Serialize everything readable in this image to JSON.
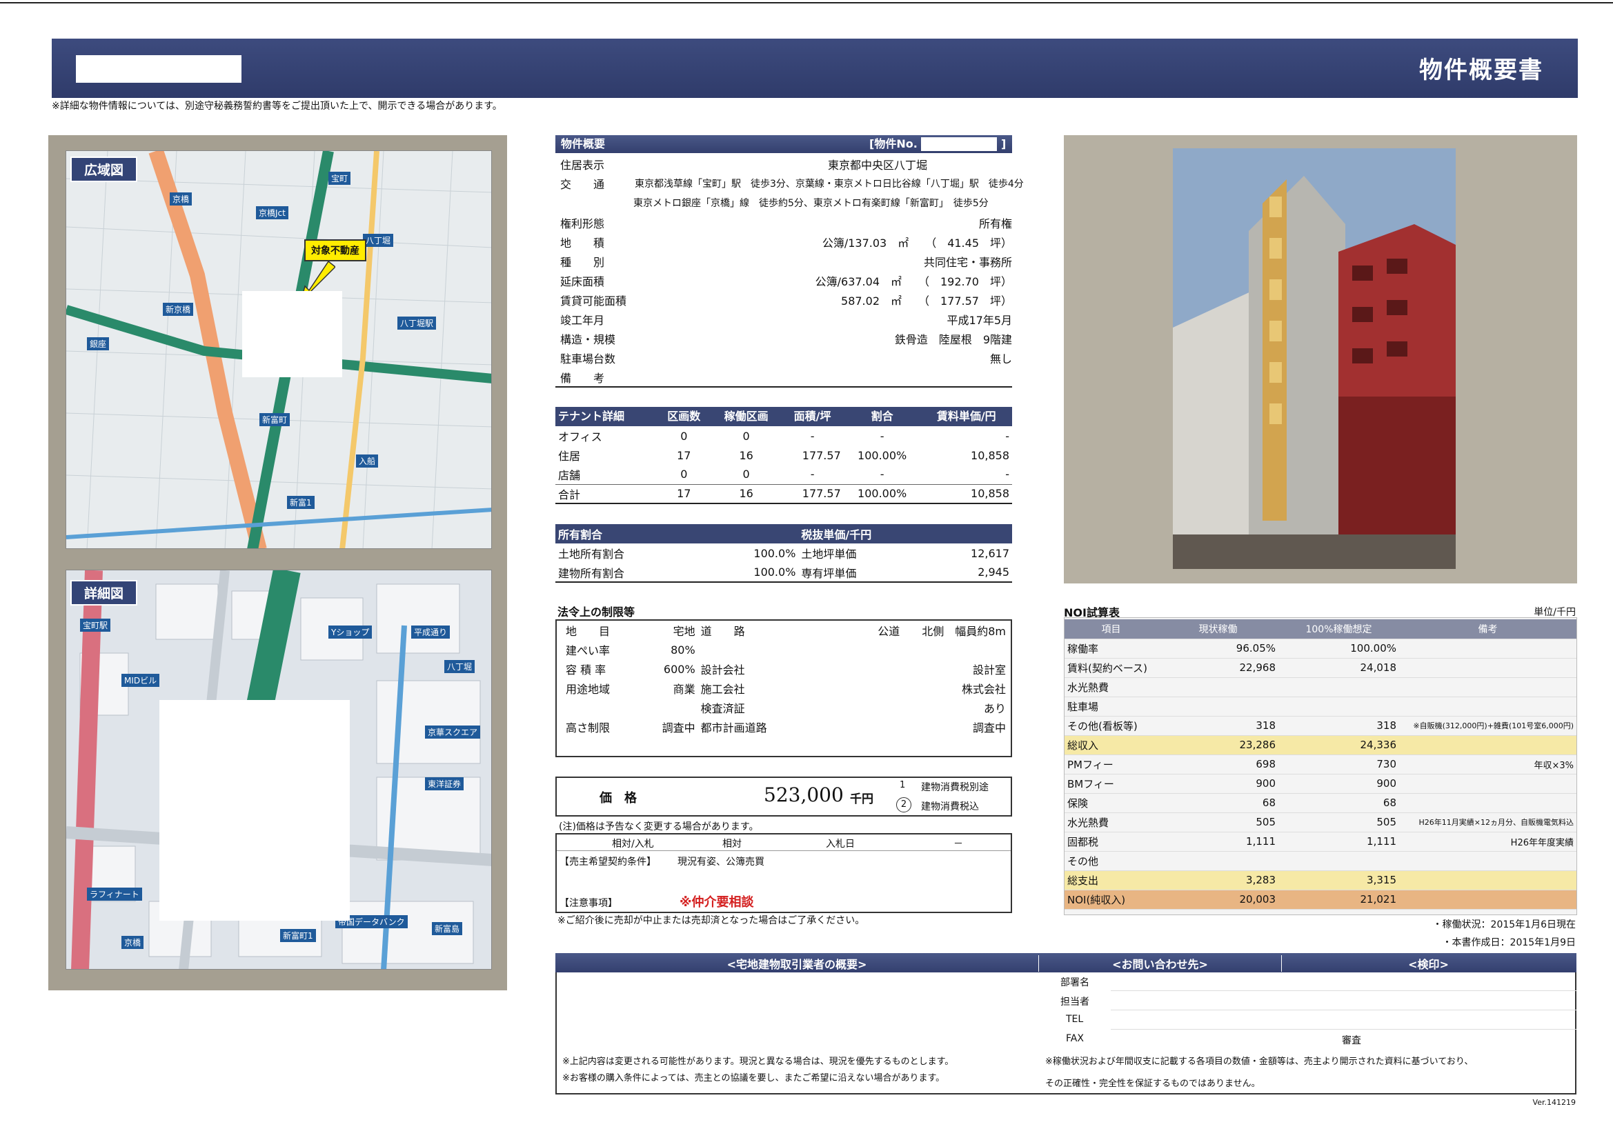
{
  "header": {
    "title": "物件概要書"
  },
  "notice_top": "※詳細な物件情報については、別途守秘義務誓約書等をご提出頂いた上で、開示できる場合があります。",
  "maps": {
    "wide_label": "広域図",
    "detail_label": "詳細図",
    "target_label": "対象不動産",
    "wide_texts": [
      "京橋",
      "八丁堀",
      "新富町",
      "入船",
      "宝町",
      "京橋Jct",
      "新京橋",
      "銀座",
      "八丁堀駅",
      "新富1"
    ],
    "detail_texts": [
      "宝町駅",
      "京橋",
      "八丁堀",
      "新富町1",
      "京華スクエア",
      "東洋証券",
      "MIDビル",
      "帝国データバンク",
      "新富島",
      "ラフィナート",
      "Yショップ",
      "平成通り"
    ]
  },
  "overview": {
    "head_title": "物件概要",
    "head_no": "[物件No.",
    "head_close": "]",
    "rows": [
      {
        "label": "住居表示",
        "value": "東京都中央区八丁堀"
      },
      {
        "label": "交　　通",
        "value": "東京都浅草線「宝町」駅　徒歩3分、京葉線・東京メトロ日比谷線「八丁堀」駅　徒歩4分"
      },
      {
        "label": "",
        "value": "東京メトロ銀座「京橋」線　徒歩約5分、東京メトロ有楽町線「新富町」　徒歩5分"
      },
      {
        "label": "権利形態",
        "value": "所有権"
      },
      {
        "label": "地　　積",
        "value": "公簿/137.03　㎡　　（　41.45　坪）"
      },
      {
        "label": "種　　別",
        "value": "共同住宅・事務所"
      },
      {
        "label": "延床面積",
        "value": "公簿/637.04　㎡　　（　192.70　坪）"
      },
      {
        "label": "賃貸可能面積",
        "value": "587.02　㎡　　（　177.57　坪）"
      },
      {
        "label": "竣工年月",
        "value": "平成17年5月"
      },
      {
        "label": "構造・規模",
        "value": "鉄骨造　陸屋根　9階建"
      },
      {
        "label": "駐車場台数",
        "value": "無し"
      },
      {
        "label": "備　　考",
        "value": ""
      }
    ]
  },
  "tenant": {
    "headers": [
      "テナント詳細",
      "区画数",
      "稼働区画",
      "面積/坪",
      "割合",
      "賃料単価/円"
    ],
    "rows": [
      [
        "オフィス",
        "0",
        "0",
        "-",
        "-",
        "-"
      ],
      [
        "住居",
        "17",
        "16",
        "177.57",
        "100.00%",
        "10,858"
      ],
      [
        "店舗",
        "0",
        "0",
        "-",
        "-",
        "-"
      ],
      [
        "合計",
        "17",
        "16",
        "177.57",
        "100.00%",
        "10,858"
      ]
    ]
  },
  "ownership": {
    "head_left": "所有割合",
    "head_right": "税抜単価/千円",
    "rows": [
      [
        "土地所有割合",
        "100.0%",
        "土地坪単価",
        "12,617"
      ],
      [
        "建物所有割合",
        "100.0%",
        "専有坪単価",
        "2,945"
      ]
    ]
  },
  "legal": {
    "title": "法令上の制限等",
    "rows": [
      [
        "地　　目",
        "宅地",
        "道　　路",
        "公道　　北側　幅員約8m"
      ],
      [
        "建ぺい率",
        "80%",
        "",
        ""
      ],
      [
        "容 積 率",
        "600%",
        "設計会社",
        "設計室"
      ],
      [
        "用途地域",
        "商業",
        "施工会社",
        "株式会社"
      ],
      [
        "",
        "",
        "検査済証",
        "あり"
      ],
      [
        "高さ制限",
        "調査中",
        "都市計画道路",
        "調査中"
      ]
    ]
  },
  "price": {
    "label": "価　格",
    "value": "523,000",
    "unit": "千円",
    "opt1_no": "1",
    "opt1": "建物消費税別途",
    "opt2_no": "2",
    "opt2": "建物消費税込",
    "note": "(注)価格は予告なく変更する場合があります。"
  },
  "conditions": {
    "c1": "相対/入札",
    "c2": "相対",
    "c3": "入札日",
    "c4": "－",
    "seller_label": "【売主希望契約条件】",
    "seller_value": "現況有姿、公簿売買",
    "caution_label": "【注意事項】",
    "caution_value": "※仲介要相談",
    "note": "※ご紹介後に売却が中止または売却済となった場合はご了承ください。"
  },
  "noi": {
    "title": "NOI試算表",
    "unit": "単位/千円",
    "headers": [
      "項目",
      "現状稼働",
      "100%稼働想定",
      "備考"
    ],
    "rows": [
      [
        "稼働率",
        "96.05%",
        "100.00%",
        ""
      ],
      [
        "賃料(契約ベース)",
        "22,968",
        "24,018",
        ""
      ],
      [
        "水光熱費",
        "",
        "",
        ""
      ],
      [
        "駐車場",
        "",
        "",
        ""
      ],
      [
        "その他(看板等)",
        "318",
        "318",
        "※自販機(312,000円)+雑費(101号室6,000円)"
      ],
      [
        "総収入",
        "23,286",
        "24,336",
        ""
      ],
      [
        "PMフィー",
        "698",
        "730",
        "年収×3%"
      ],
      [
        "BMフィー",
        "900",
        "900",
        ""
      ],
      [
        "保険",
        "68",
        "68",
        ""
      ],
      [
        "水光熱費",
        "505",
        "505",
        "H26年11月実績×12ヵ月分、自販機電気料込"
      ],
      [
        "固都税",
        "1,111",
        "1,111",
        "H26年年度実績"
      ],
      [
        "その他",
        "",
        "",
        ""
      ],
      [
        "総支出",
        "3,283",
        "3,315",
        ""
      ],
      [
        "NOI(純収入)",
        "20,003",
        "21,021",
        ""
      ]
    ],
    "status": "・稼働状況：2015年1月6日現在",
    "created": "・本書作成日：2015年1月9日"
  },
  "footer": {
    "h1": "<宅地建物取引業者の概要>",
    "h2": "<お問い合わせ先>",
    "h3": "<検印>",
    "contact_labels": [
      "部署名",
      "担当者",
      "TEL",
      "FAX"
    ],
    "review": "審査",
    "note_left1": "※上記内容は変更される可能性があります。現況と異なる場合は、現況を優先するものとします。",
    "note_left2": "※お客様の購入条件によっては、売主との協議を要し、またご希望に沿えない場合があります。",
    "note_right1": "※稼働状況および年間収支に記載する各項目の数値・金額等は、売主より開示された資料に基づいており、",
    "note_right2": "その正確性・完全性を保証するものではありません。",
    "version": "Ver.141219"
  }
}
